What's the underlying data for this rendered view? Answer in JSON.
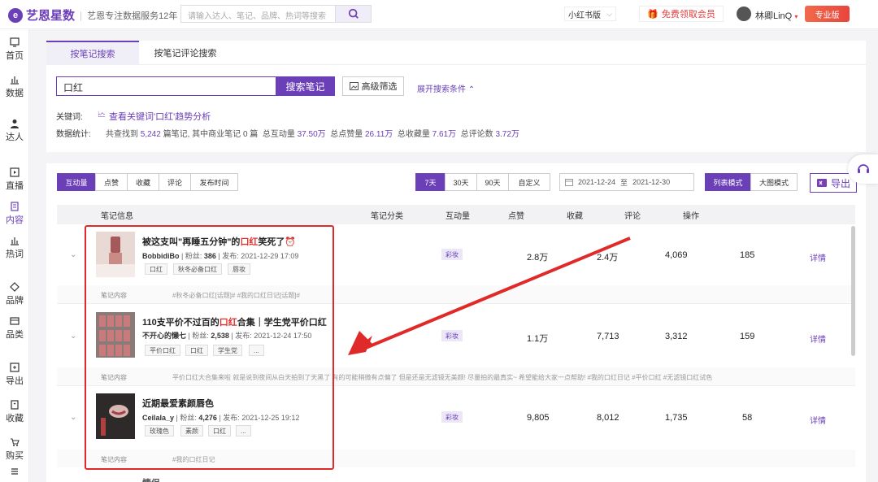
{
  "header": {
    "logo_mark": "e",
    "logo_name": "艺恩星数",
    "slogan": "艺恩专注数据服务12年",
    "search_placeholder": "请输入达人、笔记、品牌、热词等搜索",
    "site_select": "小红书版",
    "vip_label": "免费领取会员",
    "user_name": "林卿LinQ",
    "pro_badge": "专业版"
  },
  "sidebar": {
    "items": [
      {
        "label": "首页",
        "icon": "home-icon"
      },
      {
        "label": "数据",
        "icon": "bar-chart-icon"
      },
      {
        "label": "达人",
        "icon": "person-icon"
      },
      {
        "label": "直播",
        "icon": "play-icon"
      },
      {
        "label": "内容",
        "icon": "document-icon"
      },
      {
        "label": "热词",
        "icon": "bar-chart-icon"
      },
      {
        "label": "品牌",
        "icon": "diamond-icon"
      },
      {
        "label": "品类",
        "icon": "category-icon"
      },
      {
        "label": "导出",
        "icon": "export-icon"
      },
      {
        "label": "收藏",
        "icon": "bookmark-icon"
      },
      {
        "label": "购买",
        "icon": "cart-icon"
      }
    ]
  },
  "search_panel": {
    "tabs": [
      "按笔记搜索",
      "按笔记评论搜索"
    ],
    "keyword_value": "口红",
    "search_button": "搜索笔记",
    "advanced_filter": "高级筛选",
    "expand_conditions": "展开搜索条件",
    "keyword_label": "关键词:",
    "keyword_trend_link": "查看关键词'口红'趋势分析",
    "stats_label": "数据统计:",
    "stats": {
      "p1": "共查找到",
      "notes": "5,242",
      "p2": "篇笔记, 其中商业笔记",
      "biz": "0",
      "p3": "篇",
      "interact_label": "总互动量",
      "interact": "37.50万",
      "likes_label": "总点赞量",
      "likes": "26.11万",
      "fav_label": "总收藏量",
      "fav": "7.61万",
      "comments_label": "总评论数",
      "comments": "3.72万"
    }
  },
  "result_panel": {
    "sort_tabs": [
      "互动量",
      "点赞",
      "收藏",
      "评论",
      "发布时间"
    ],
    "range_tabs": [
      "7天",
      "30天",
      "90天",
      "自定义"
    ],
    "date_start": "2021-12-24",
    "date_to": "至",
    "date_end": "2021-12-30",
    "view_tabs": [
      "列表模式",
      "大图模式"
    ],
    "export_label": "导出",
    "columns": [
      "笔记信息",
      "笔记分类",
      "互动量",
      "点赞",
      "收藏",
      "评论",
      "操作"
    ],
    "rows": [
      {
        "title_pre": "被这支叫\"再睡五分钟\"的",
        "title_hl": "口红",
        "title_post": "笑死了⏰",
        "author": "BobbidiBo",
        "fans_label": "粉丝:",
        "fans": "386",
        "pub_label": "发布:",
        "pub": "2021-12-29 17:09",
        "tags": [
          "口红",
          "秋冬必备口红",
          "唇妆"
        ],
        "category": "彩妆",
        "interact": "2.8万",
        "likes": "2.4万",
        "fav": "4,069",
        "comments": "185",
        "action": "详情",
        "content_label": "笔记内容",
        "content": "#秋冬必备口红[话题]# #我的口红日记[话题]#"
      },
      {
        "title_pre": "110支平价不过百的",
        "title_hl": "口红",
        "title_post": "合集｜学生党平价口红",
        "author": "不开心的懒七",
        "fans_label": "粉丝:",
        "fans": "2,538",
        "pub_label": "发布:",
        "pub": "2021-12-24 17:50",
        "tags": [
          "平价口红",
          "口红",
          "学生党",
          "..."
        ],
        "category": "彩妆",
        "interact": "1.1万",
        "likes": "7,713",
        "fav": "3,312",
        "comments": "159",
        "action": "详情",
        "content_label": "笔记内容",
        "content": "平价口红大合集来啦 就是说到夜间从白天拍到了天黑了 有的可能稍微有点偏了 但是还是无滤镜无美颜! 尽量拍的最真实~ 希望能给大家一点帮助! #我的口红日记 #平价口红 #无滤镜口红试色"
      },
      {
        "title_pre": "近期最爱素颜唇色",
        "title_hl": "",
        "title_post": "",
        "author": "Ceilala_y",
        "fans_label": "粉丝:",
        "fans": "4,276",
        "pub_label": "发布:",
        "pub": "2021-12-25 19:12",
        "tags": [
          "玫瑰色",
          "素颜",
          "口红",
          "..."
        ],
        "category": "彩妆",
        "interact": "9,805",
        "likes": "8,012",
        "fav": "1,735",
        "comments": "58",
        "action": "详情",
        "content_label": "笔记内容",
        "content": "#我的口红日记"
      }
    ],
    "next_row_partial": "情侣"
  },
  "colors": {
    "brand": "#6b3fb8",
    "highlight_red": "#e0302a",
    "annotation_red": "#e02a2a"
  }
}
